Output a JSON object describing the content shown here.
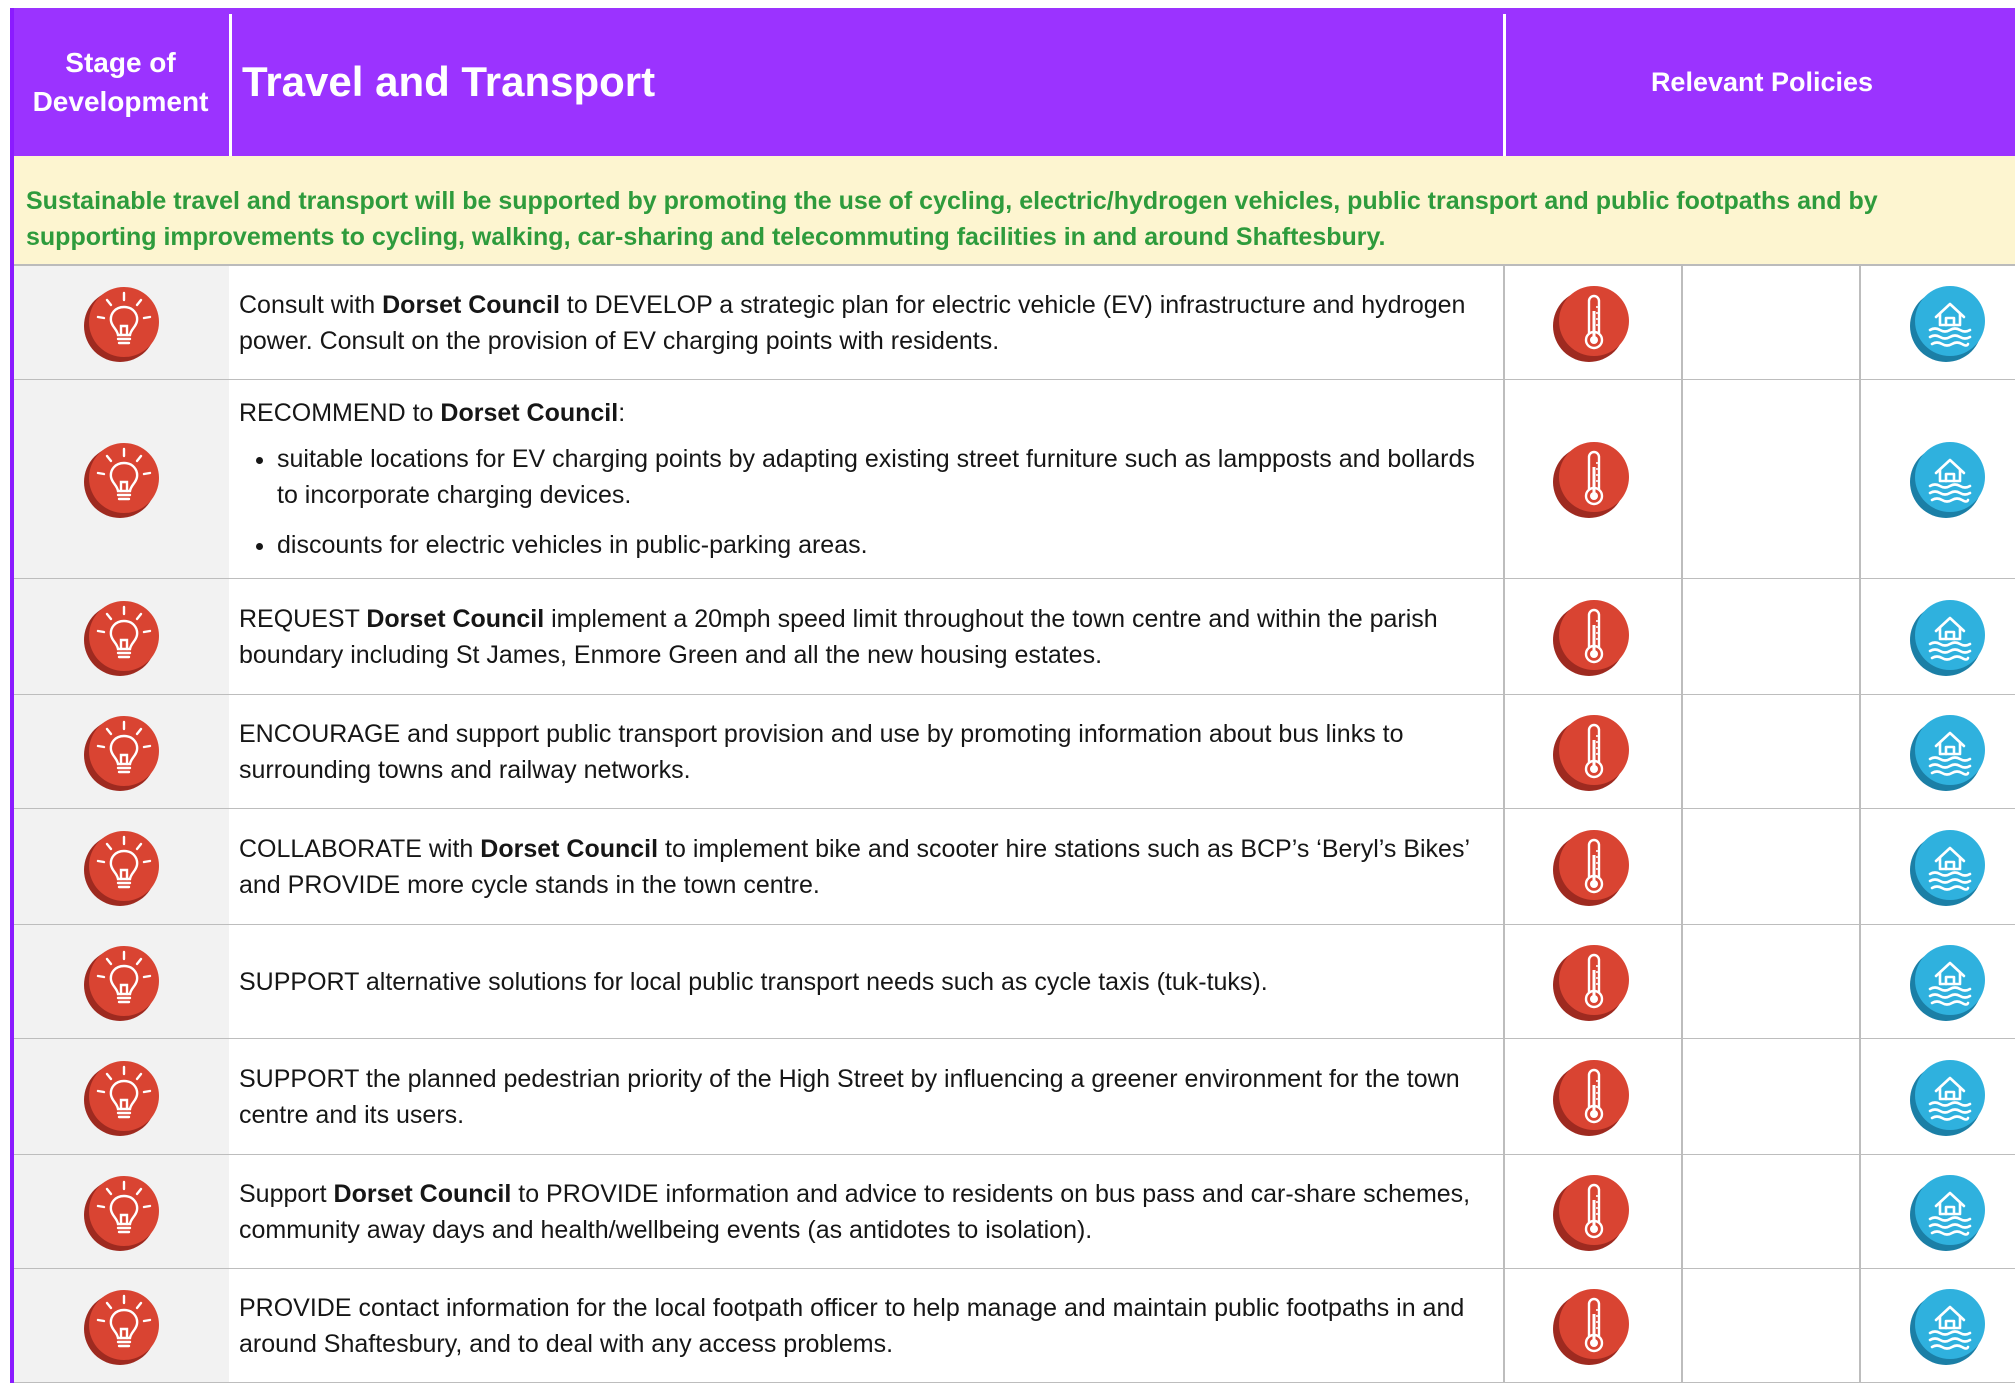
{
  "header": {
    "stage_label": "Stage of Development",
    "title": "Travel and Transport",
    "policies_label": "Relevant Policies"
  },
  "summary": "Sustainable travel and transport will be supported by promoting the use of cycling, electric/hydrogen vehicles, public transport and public footpaths and by supporting improvements to cycling, walking, car-sharing and telecommuting facilities in and around Shaftesbury.",
  "colors": {
    "header": "#9b33ff",
    "summary_text": "#2e9b3c",
    "summary_bg": "#fdf5d0",
    "stage_icon": "#d94432",
    "temperature_icon": "#d94432",
    "flood_icon": "#2fb1de"
  },
  "icons": {
    "stage": "lightbulb-icon",
    "policy_1": "thermometer-icon",
    "policy_3": "flood-house-icon"
  },
  "rows": [
    {
      "parts": [
        {
          "t": "Consult with ",
          "b": false
        },
        {
          "t": "Dorset Council",
          "b": true
        },
        {
          "t": " to DEVELOP a strategic plan for electric vehicle (EV) infrastructure and hydrogen power. Consult on the provision of EV charging points with residents.",
          "b": false
        }
      ],
      "bullets": []
    },
    {
      "parts": [
        {
          "t": "RECOMMEND to ",
          "b": false
        },
        {
          "t": "Dorset Council",
          "b": true
        },
        {
          "t": ":",
          "b": false
        }
      ],
      "bullets": [
        "suitable locations for EV charging points by adapting existing street furniture such as lampposts and bollards to incorporate charging devices.",
        "discounts for electric vehicles in public-parking areas."
      ]
    },
    {
      "parts": [
        {
          "t": "REQUEST ",
          "b": false
        },
        {
          "t": "Dorset Council",
          "b": true
        },
        {
          "t": " implement a 20mph speed limit throughout the town centre and within the parish boundary including St James, Enmore Green and all the new housing estates.",
          "b": false
        }
      ],
      "bullets": []
    },
    {
      "parts": [
        {
          "t": "ENCOURAGE and support public transport provision and use by promoting information about bus links to surrounding towns and railway networks.",
          "b": false
        }
      ],
      "bullets": []
    },
    {
      "parts": [
        {
          "t": "COLLABORATE with ",
          "b": false
        },
        {
          "t": "Dorset Council",
          "b": true
        },
        {
          "t": " to implement bike and scooter hire stations such as BCP’s ‘Beryl’s Bikes’ and PROVIDE more cycle stands in the town centre.",
          "b": false
        }
      ],
      "bullets": []
    },
    {
      "parts": [
        {
          "t": "SUPPORT alternative solutions for local public transport needs such as cycle taxis (tuk-tuks).",
          "b": false
        }
      ],
      "bullets": []
    },
    {
      "parts": [
        {
          "t": "SUPPORT the planned pedestrian priority of the High Street by influencing a greener environment for the town centre and its users.",
          "b": false
        }
      ],
      "bullets": []
    },
    {
      "parts": [
        {
          "t": "Support ",
          "b": false
        },
        {
          "t": "Dorset Council",
          "b": true
        },
        {
          "t": " to PROVIDE information and advice to residents on bus pass and car-share schemes, community away days and health/wellbeing events (as antidotes to isolation).",
          "b": false
        }
      ],
      "bullets": []
    },
    {
      "parts": [
        {
          "t": "PROVIDE contact information for the local footpath officer to help manage and maintain public footpaths in and around Shaftesbury, and to deal with any access problems.",
          "b": false
        }
      ],
      "bullets": []
    }
  ]
}
